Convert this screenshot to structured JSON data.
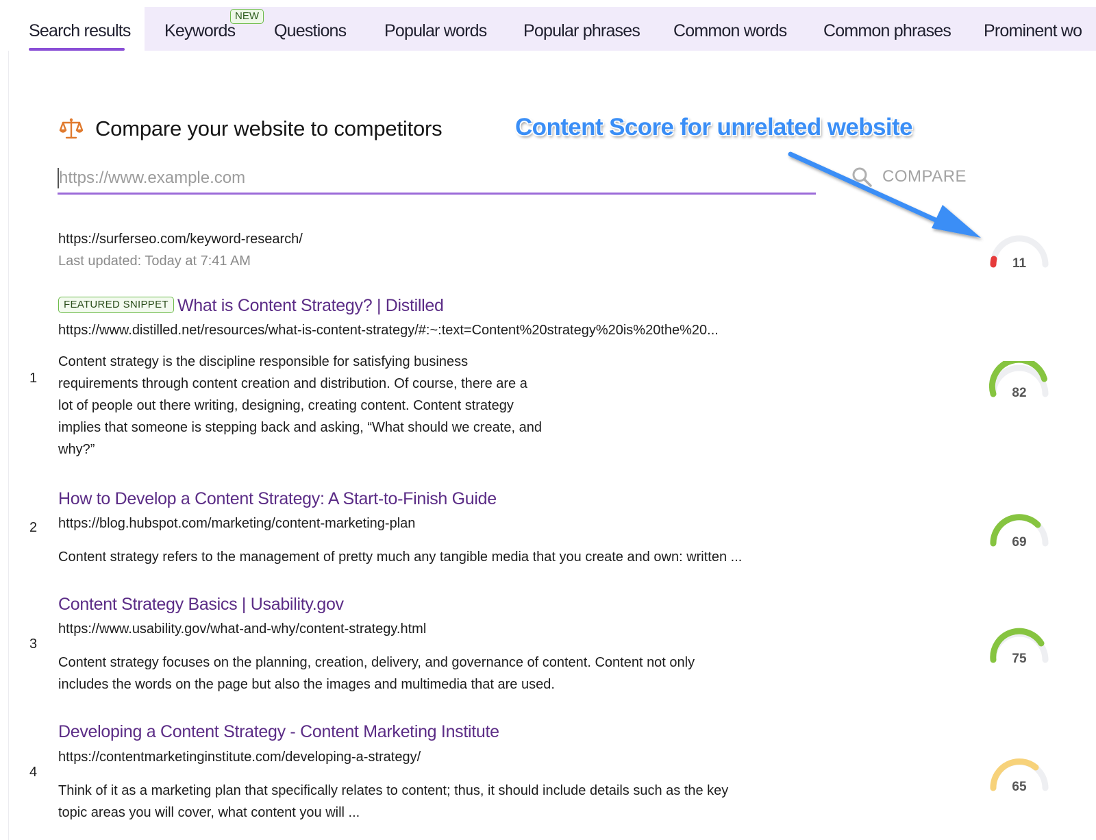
{
  "tabs": [
    {
      "label": "Search results",
      "active": true
    },
    {
      "label": "Keywords",
      "badge": "NEW"
    },
    {
      "label": "Questions"
    },
    {
      "label": "Popular words"
    },
    {
      "label": "Popular phrases"
    },
    {
      "label": "Common words"
    },
    {
      "label": "Common phrases"
    },
    {
      "label": "Prominent wo"
    }
  ],
  "compare": {
    "icon": "balance-scale-icon",
    "title": "Compare your website to competitors",
    "placeholder": "https://www.example.com",
    "button_label": "COMPARE",
    "button_icon": "search-icon"
  },
  "annotation": {
    "text": "Content Score for unrelated website",
    "color": "#3a8ef6"
  },
  "own_site": {
    "url": "https://surferseo.com/keyword-research/",
    "last_updated": "Last updated: Today at 7:41 AM",
    "score": 11,
    "score_fraction": 0.11
  },
  "results": [
    {
      "rank": "1",
      "badge": "FEATURED SNIPPET",
      "title": "What is Content Strategy? | Distilled",
      "url": "https://www.distilled.net/resources/what-is-content-strategy/#:~:text=Content%20strategy%20is%20the%20...",
      "description_lines": [
        "Content strategy is the discipline responsible for satisfying business",
        "requirements through content creation and distribution. Of course, there are a",
        "lot of people out there writing, designing, creating content. Content strategy",
        "implies that someone is stepping back and asking, “What should we create, and",
        "why?”"
      ],
      "score": 82
    },
    {
      "rank": "2",
      "title": "How to Develop a Content Strategy: A Start-to-Finish Guide",
      "url": "https://blog.hubspot.com/marketing/content-marketing-plan",
      "description_lines": [
        "Content strategy refers to the management of pretty much any tangible media that you create and own: written ..."
      ],
      "score": 69
    },
    {
      "rank": "3",
      "title": "Content Strategy Basics | Usability.gov",
      "url": "https://www.usability.gov/what-and-why/content-strategy.html",
      "description_lines": [
        "Content strategy focuses on the planning, creation, delivery, and governance of content. Content not only",
        "includes the words on the page but also the images and multimedia that are used."
      ],
      "score": 75
    },
    {
      "rank": "4",
      "title": "Developing a Content Strategy - Content Marketing Institute",
      "url": "https://contentmarketinginstitute.com/developing-a-strategy/",
      "description_lines": [
        "Think of it as a marketing plan that specifically relates to content; thus, it should include details such as the key",
        "topic areas you will cover, what content you will ..."
      ],
      "score": 65
    }
  ],
  "colors": {
    "accent": "#8a4fd6",
    "tab_bg": "#f1ebfa",
    "link": "#5b2c86",
    "score_high": "#86c440",
    "score_mid": "#f7d27a",
    "score_low": "#e63b3b",
    "gauge_track": "#eeeff2"
  }
}
